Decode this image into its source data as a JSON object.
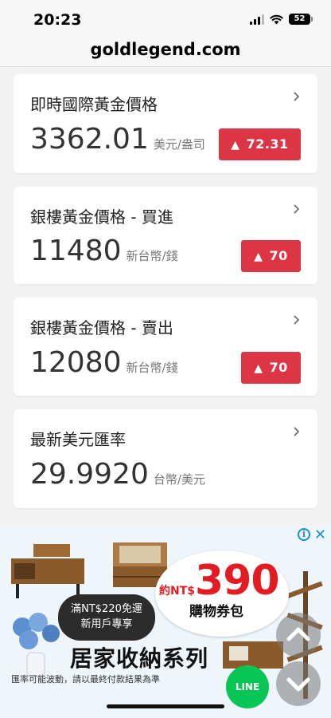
{
  "status": {
    "time": "20:23",
    "battery": "52"
  },
  "browser": {
    "url": "goldlegend.com"
  },
  "cards": [
    {
      "title": "即時國際黃金價格",
      "price": "3362.01",
      "unit": "美元/盎司",
      "change": "72.31",
      "direction": "up"
    },
    {
      "title": "銀樓黃金價格 - 買進",
      "price": "11480",
      "unit": "新台幣/錢",
      "change": "70",
      "direction": "up"
    },
    {
      "title": "銀樓黃金價格 - 賣出",
      "price": "12080",
      "unit": "新台幣/錢",
      "change": "70",
      "direction": "up"
    },
    {
      "title": "最新美元匯率",
      "price": "29.9920",
      "unit": "台幣/美元"
    }
  ],
  "ad": {
    "price_prefix": "約NT$",
    "price_value": "390",
    "voucher": "購物券包",
    "promo_line1": "滿NT$220免運",
    "promo_line2": "新用戶專享",
    "headline": "居家收納系列",
    "disclaimer": "匯率可能波動，請以最終付款結果為準",
    "line_label": "LINE"
  },
  "colors": {
    "badge_up": "#dc3545",
    "line_green": "#06c755",
    "ad_red": "#e31b23"
  },
  "icons": [
    "signal-icon",
    "wifi-icon",
    "battery-icon",
    "chevron-right-icon",
    "up-arrow-icon",
    "ad-info-icon",
    "ad-close-icon",
    "chevron-up-icon",
    "chevron-down-icon"
  ]
}
